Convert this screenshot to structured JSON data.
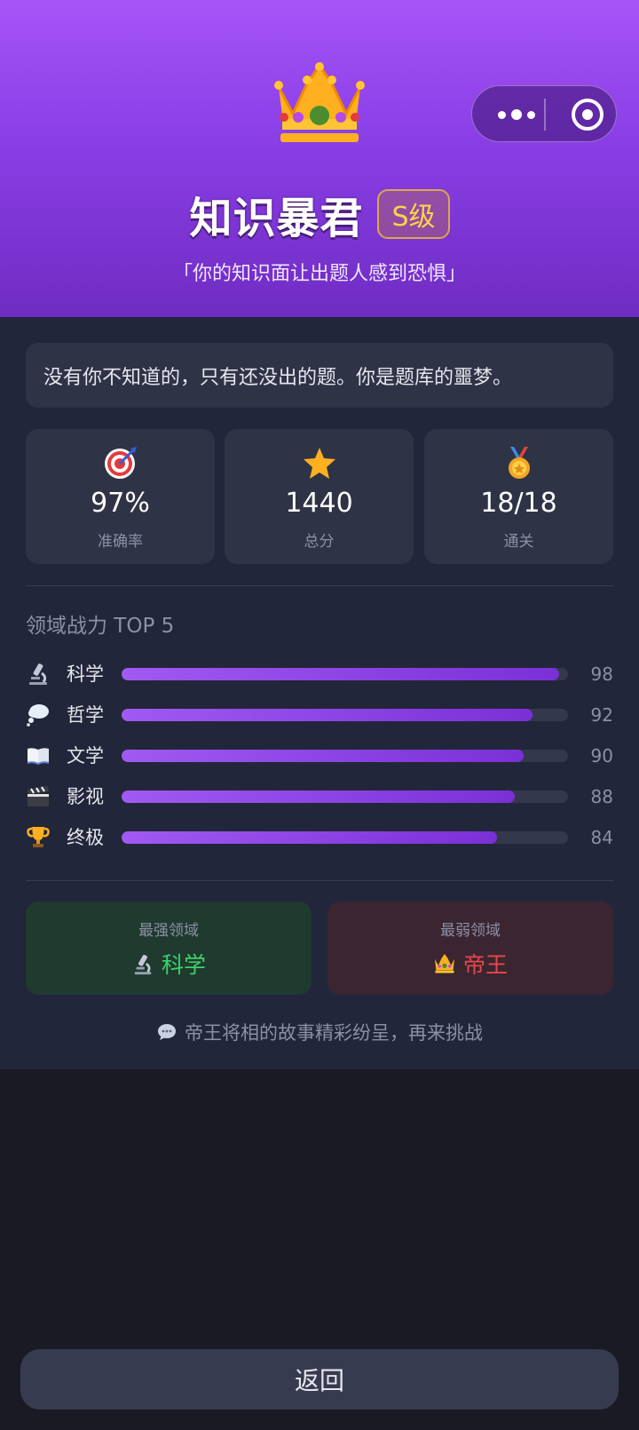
{
  "header": {
    "title": "知识暴君",
    "grade": "S级",
    "quote": "「你的知识面让出题人感到恐惧」",
    "icon": "crown-icon"
  },
  "capsule": {
    "icons": [
      "more-dots-icon",
      "record-target-icon"
    ]
  },
  "description": "没有你不知道的，只有还没出的题。你是题库的噩梦。",
  "stats": [
    {
      "icon": "dart-target-icon",
      "value": "97%",
      "label": "准确率"
    },
    {
      "icon": "star-icon",
      "value": "1440",
      "label": "总分"
    },
    {
      "icon": "medal-icon",
      "value": "18/18",
      "label": "通关"
    }
  ],
  "ranking": {
    "title": "领域战力 TOP 5",
    "items": [
      {
        "icon": "microscope-icon",
        "name": "科学",
        "value": 98
      },
      {
        "icon": "thought-bubble-icon",
        "name": "哲学",
        "value": 92
      },
      {
        "icon": "open-book-icon",
        "name": "文学",
        "value": 90
      },
      {
        "icon": "clapper-icon",
        "name": "影视",
        "value": 88
      },
      {
        "icon": "trophy-icon",
        "name": "终极",
        "value": 84
      }
    ]
  },
  "strongest": {
    "label": "最强领域",
    "icon": "microscope-icon",
    "name": "科学"
  },
  "weakest": {
    "label": "最弱领域",
    "icon": "crown-icon",
    "name": "帝王"
  },
  "tip": {
    "icon": "speech-bubble-icon",
    "text": "帝王将相的故事精彩纷呈，再来挑战"
  },
  "back_button": "返回",
  "colors": {
    "accent": "#9b4ff0",
    "strong": "#3fcf6b",
    "weak": "#e5484d",
    "grade": "#ffd24a"
  }
}
